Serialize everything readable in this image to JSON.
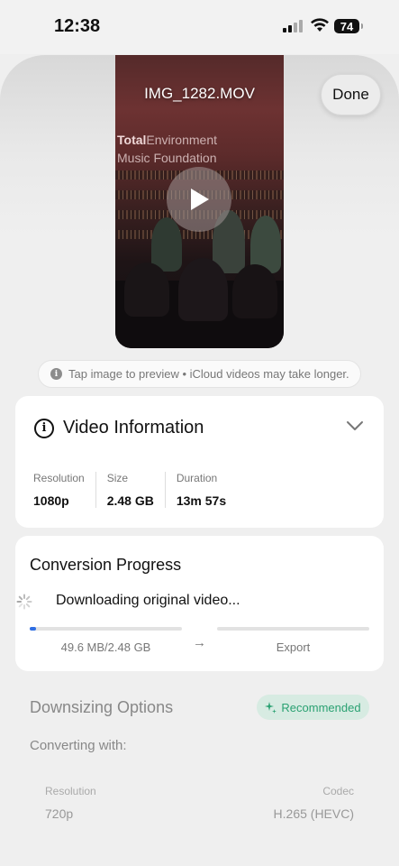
{
  "status_bar": {
    "time": "12:38",
    "battery": "74"
  },
  "video": {
    "title": "IMG_1282.MOV",
    "overlay_line1_bold": "Total",
    "overlay_line1_rest": "Environment",
    "overlay_line2": "Music Foundation"
  },
  "header": {
    "done_label": "Done"
  },
  "hint": {
    "text": "Tap image to preview • iCloud videos may take longer."
  },
  "video_info": {
    "title": "Video Information",
    "stats": [
      {
        "label": "Resolution",
        "value": "1080p"
      },
      {
        "label": "Size",
        "value": "2.48 GB"
      },
      {
        "label": "Duration",
        "value": "13m 57s"
      }
    ]
  },
  "conversion": {
    "title": "Conversion Progress",
    "status": "Downloading original video...",
    "download_progress": 0.04,
    "download_label": "49.6 MB/2.48 GB",
    "export_progress": 0,
    "export_label": "Export"
  },
  "downsizing": {
    "title": "Downsizing Options",
    "badge": "Recommended",
    "converting_with": "Converting with:",
    "resolution_label": "Resolution",
    "resolution_value": "720p",
    "codec_label": "Codec",
    "codec_value": "H.265 (HEVC)"
  },
  "colors": {
    "accent_blue": "#2f6ee3",
    "recommended_green": "#2aa172",
    "recommended_bg": "#d7ebe2"
  }
}
